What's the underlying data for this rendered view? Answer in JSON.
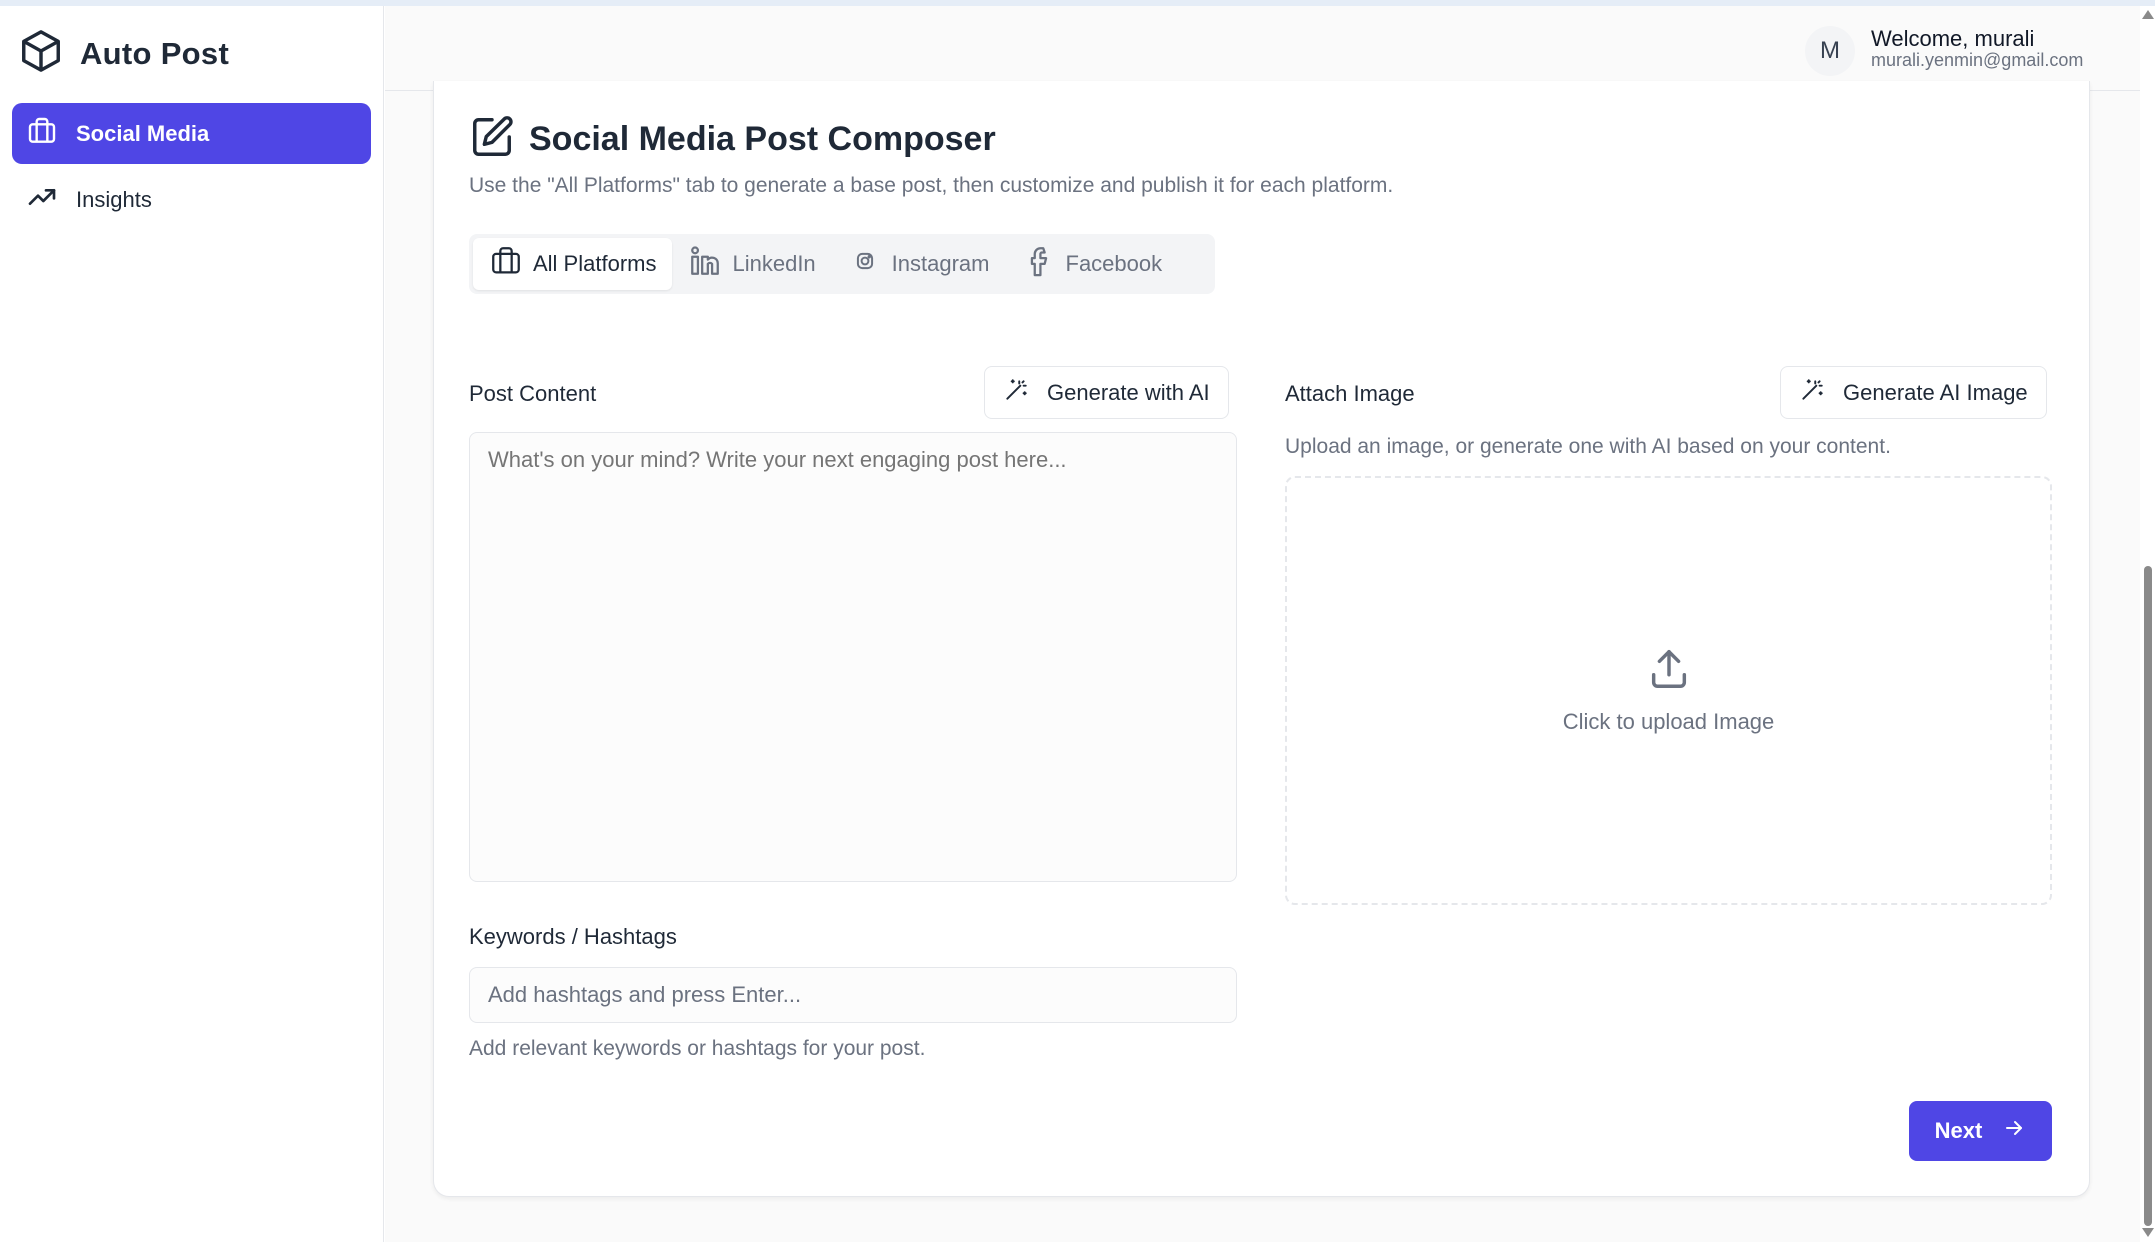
{
  "app": {
    "name": "Auto Post"
  },
  "sidebar": {
    "items": [
      {
        "label": "Social Media",
        "icon": "briefcase-icon",
        "active": true
      },
      {
        "label": "Insights",
        "icon": "trending-up-icon",
        "active": false
      }
    ]
  },
  "header": {
    "avatar_initial": "M",
    "welcome": "Welcome, murali",
    "email": "murali.yenmin@gmail.com"
  },
  "composer": {
    "title": "Social Media Post Composer",
    "subtitle": "Use the \"All Platforms\" tab to generate a base post, then customize and publish it for each platform.",
    "tabs": [
      {
        "label": "All Platforms",
        "icon": "briefcase-icon",
        "active": true
      },
      {
        "label": "LinkedIn",
        "icon": "linkedin-icon",
        "active": false
      },
      {
        "label": "Instagram",
        "icon": "instagram-icon",
        "active": false
      },
      {
        "label": "Facebook",
        "icon": "facebook-icon",
        "active": false
      }
    ],
    "post_content_label": "Post Content",
    "generate_ai_label": "Generate with AI",
    "post_placeholder": "What's on your mind? Write your next engaging post here...",
    "attach_image_label": "Attach Image",
    "generate_ai_image_label": "Generate AI Image",
    "attach_hint": "Upload an image, or generate one with AI based on your content.",
    "upload_text": "Click to upload Image",
    "keywords_label": "Keywords / Hashtags",
    "keywords_placeholder": "Add hashtags and press Enter...",
    "keywords_hint": "Add relevant keywords or hashtags for your post.",
    "next_label": "Next"
  },
  "colors": {
    "accent": "#4f46e5",
    "muted_text": "#6b7280",
    "border": "#e5e7eb"
  }
}
